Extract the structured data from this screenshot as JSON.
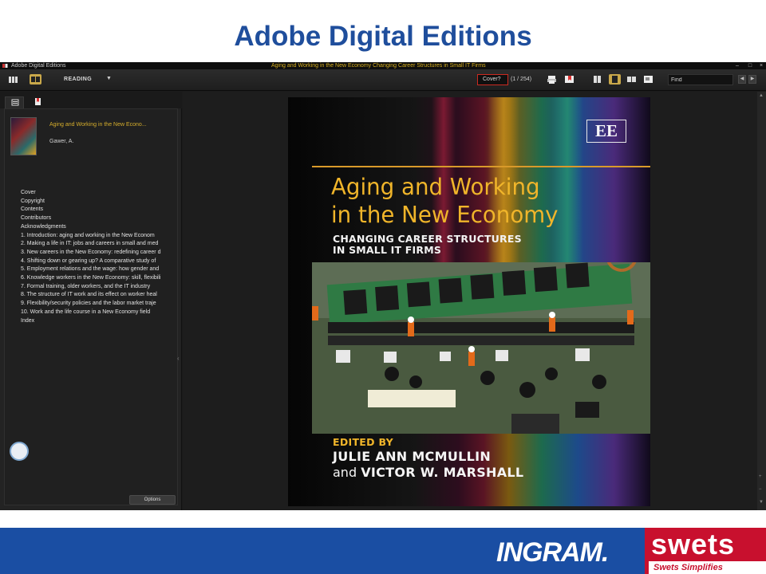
{
  "slide": {
    "title": "Adobe Digital Editions"
  },
  "window": {
    "app_name": "Adobe Digital Editions",
    "document_title": "Aging and Working in the New Economy Changing Career Structures in Small IT Firms"
  },
  "toolbar": {
    "view_mode": "READING",
    "page_field_value": "Cover?",
    "page_count": "(1 / 254)",
    "find_placeholder": "Find"
  },
  "sidebar": {
    "book_title": "Aging and Working in the New Econo...",
    "book_author": "Gawer, A.",
    "toc": [
      "Cover",
      "Copyright",
      "Contents",
      "Contributors",
      "Acknowledgments",
      "1. Introduction: aging and working in the New Econom",
      "2. Making a life in IT: jobs and careers in small and med",
      "3. New careers in the New Economy: redefining career d",
      "4. Shifting down or gearing up? A comparative study of",
      "5. Employment relations and the wage: how gender and",
      "6. Knowledge workers in the New Economy: skill, flexibili",
      "7. Formal training, older workers, and the IT industry",
      "8. The structure of IT work and its effect on worker heal",
      "9. Flexibility/security policies and the labor market traje",
      "10. Work and the life course in a New Economy field",
      "Index"
    ],
    "options_label": "Options"
  },
  "cover": {
    "publisher_mark": "EE",
    "title_line1": "Aging and Working",
    "title_line2": "in the New Economy",
    "subtitle_line1": "CHANGING CAREER STRUCTURES",
    "subtitle_line2": "IN SMALL IT FIRMS",
    "edited_by": "EDITED BY",
    "editor1": "JULIE ANN MCMULLIN",
    "editor2_prefix": "and ",
    "editor2_name": "VICTOR W. MARSHALL"
  },
  "footer": {
    "ingram_logo": "INGRAM.",
    "swets_logo": "swets",
    "swets_tagline": "Swets Simplifies"
  },
  "icons": {
    "library": "library-view-icon",
    "reading": "reading-view-icon",
    "print": "print-icon",
    "bookmark": "bookmark-icon"
  },
  "colors": {
    "slide_title": "#1f4e9c",
    "footer_blue": "#1a4ea3",
    "swets_red": "#c8102e",
    "accent_gold": "#d6ae2c",
    "cover_title": "#f0b52a"
  }
}
